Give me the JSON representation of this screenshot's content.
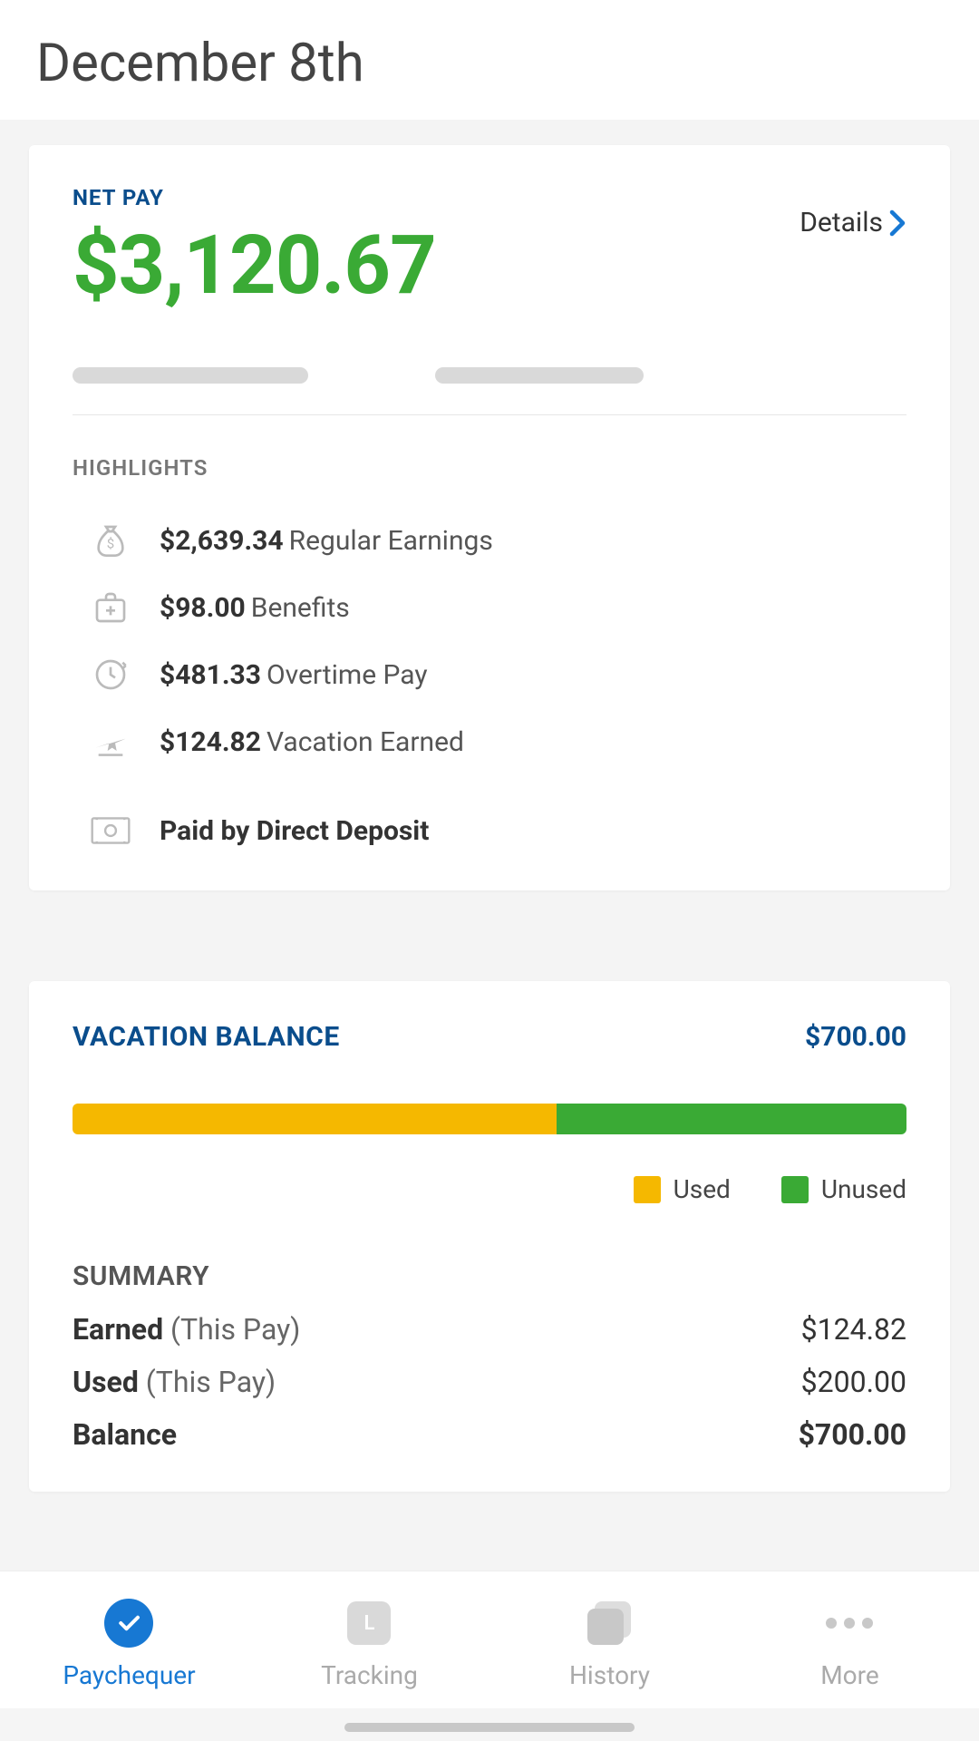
{
  "header": {
    "title": "December 8th"
  },
  "netpay": {
    "label": "NET PAY",
    "amount": "$3,120.67",
    "details_label": "Details"
  },
  "highlights": {
    "label": "HIGHLIGHTS",
    "items": [
      {
        "amount": "$2,639.34",
        "label": "Regular Earnings",
        "icon": "money-bag"
      },
      {
        "amount": "$98.00",
        "label": "Benefits",
        "icon": "medical"
      },
      {
        "amount": "$481.33",
        "label": "Overtime Pay",
        "icon": "clock"
      },
      {
        "amount": "$124.82",
        "label": "Vacation Earned",
        "icon": "plane"
      }
    ],
    "deposit": {
      "label": "Paid by Direct Deposit",
      "icon": "cash"
    }
  },
  "vacation": {
    "title": "VACATION BALANCE",
    "total": "$700.00",
    "used_pct": 58,
    "legend": {
      "used": "Used",
      "unused": "Unused"
    },
    "summary_title": "SUMMARY",
    "rows": [
      {
        "label_bold": "Earned",
        "label_sub": "(This Pay)",
        "value": "$124.82"
      },
      {
        "label_bold": "Used",
        "label_sub": "(This Pay)",
        "value": "$200.00"
      },
      {
        "label_bold": "Balance",
        "label_sub": "",
        "value": "$700.00"
      }
    ]
  },
  "tabs": [
    {
      "label": "Paychequer",
      "icon": "check",
      "active": true
    },
    {
      "label": "Tracking",
      "icon": "square",
      "active": false
    },
    {
      "label": "History",
      "icon": "stack",
      "active": false
    },
    {
      "label": "More",
      "icon": "dots",
      "active": false
    }
  ],
  "colors": {
    "brand_blue": "#0a4d8c",
    "link_blue": "#1778d3",
    "green": "#3aaa35",
    "amber": "#f5b800"
  }
}
